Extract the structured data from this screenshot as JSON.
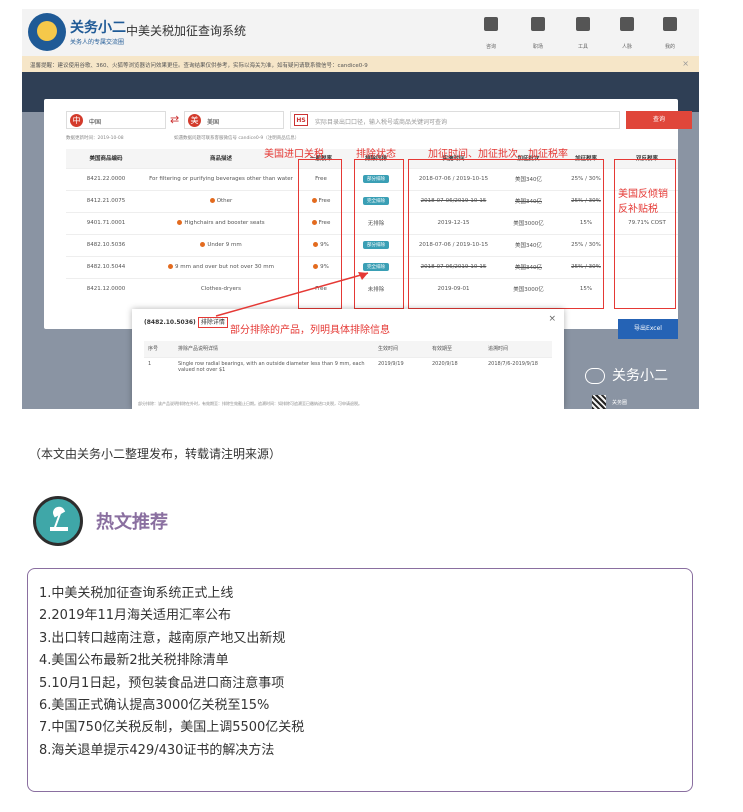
{
  "app": {
    "brand": "关务小二",
    "brand_sub": "关务人的专属交流圈",
    "system_title": "中美关税加征查询系统"
  },
  "nav": [
    {
      "label": "咨询",
      "icon": "news-icon"
    },
    {
      "label": "职场",
      "icon": "briefcase-icon"
    },
    {
      "label": "工具",
      "icon": "tools-icon"
    },
    {
      "label": "人脉",
      "icon": "people-icon"
    },
    {
      "label": "我的",
      "icon": "user-icon"
    }
  ],
  "notice": {
    "text": "温馨提醒：建议使用谷歌、360、火狐等浏览器访问效果更佳。查询结果仅供参考，实际以海关为准，如有疑问请联系微信号：candice0-9",
    "close": "×"
  },
  "search": {
    "origin": "中国",
    "origin_flag": "中",
    "dest": "美国",
    "dest_flag": "美",
    "swap": "⇄",
    "hs_tag": "HS",
    "placeholder": "实际目录出口口径，输入税号或商品关键词可查询",
    "button": "查询",
    "meta1": "数据更新时间：2019-10-08",
    "meta2": "如遇数据问题可联系客服微信号 candice0-9（注明商品信息）"
  },
  "table": {
    "headers": [
      "美国商品编码",
      "商品描述",
      "一般税率",
      "排除同排",
      "实施时间",
      "加征批次",
      "加征税率",
      "双反税率"
    ],
    "rows": [
      {
        "code": "8421.22.0000",
        "desc": "For filtering or purifying beverages other than water",
        "rate": "Free",
        "dot": false,
        "exclusion": "部分排除",
        "excl_color": "#3a9fb5",
        "time": "2018-07-06 / 2019-10-15",
        "batch": "美国340亿",
        "add": "25% / 30%",
        "strike": false,
        "cvd": ""
      },
      {
        "code": "8412.21.0075",
        "desc": "Other",
        "rate": "Free",
        "dot": true,
        "exclusion": "完全排除",
        "excl_color": "#3a9fb5",
        "time": "2018-07-06/2019-10-15",
        "batch": "美国340亿",
        "add": "25% / 30%",
        "strike": true,
        "cvd": ""
      },
      {
        "code": "9401.71.0001",
        "desc": "Highchairs and booster seats",
        "rate": "Free",
        "dot": true,
        "exclusion": "无排除",
        "excl_color": "",
        "time": "2019-12-15",
        "batch": "美国3000亿",
        "add": "15%",
        "strike": false,
        "cvd": "79.71% COST"
      },
      {
        "code": "8482.10.5036",
        "desc": "Under 9 mm",
        "rate": "9%",
        "dot": true,
        "exclusion": "部分排除",
        "excl_color": "#3a9fb5",
        "time": "2018-07-06 / 2019-10-15",
        "batch": "美国340亿",
        "add": "25% / 30%",
        "strike": false,
        "cvd": ""
      },
      {
        "code": "8482.10.5044",
        "desc": "9 mm and over but not over 30 mm",
        "rate": "9%",
        "dot": true,
        "exclusion": "完全排除",
        "excl_color": "#3a9fb5",
        "time": "2018-07-06/2019-10-15",
        "batch": "美国340亿",
        "add": "25% / 30%",
        "strike": true,
        "cvd": ""
      },
      {
        "code": "8421.12.0000",
        "desc": "Clothes-dryers",
        "rate": "Free",
        "dot": false,
        "exclusion": "未排除",
        "excl_color": "",
        "time": "2019-09-01",
        "batch": "美国3000亿",
        "add": "15%",
        "strike": false,
        "cvd": ""
      }
    ]
  },
  "annotations": {
    "rate_label": "美国进口关税",
    "excl_label": "排除状态",
    "time_label": "加征时间、加征批次、加征税率",
    "cvd_label": "美国反倾销反补贴税",
    "partial_label": "部分排除的产品，列明具体排除信息"
  },
  "modal": {
    "title_code": "(8482.10.5036)",
    "title_mark": "排除详情",
    "close": "×",
    "headers": [
      "序号",
      "排除产品说明详情",
      "生效时间",
      "有效期至",
      "追溯时间"
    ],
    "rows": [
      {
        "no": "1",
        "detail": "Single row radial bearings, with an outside diameter less than 9 mm, each valued not over $1",
        "start": "2019/9/19",
        "end": "2020/9/18",
        "retro": "2018/7/6-2019/9/18"
      }
    ],
    "footer": "部分排除：该产品说明排除在外时，有效期至：排除生效截止日期。追溯时间：如排除可追溯至已缴纳进口关税，可申请退税。"
  },
  "excel_button": "导出Excel",
  "watermark": "关务小二",
  "watermark_small": "关务圈",
  "source_note": "（本文由关务小二整理发布，转载请注明来源）",
  "recommend": {
    "title": "热文推荐",
    "items": [
      "1.中美关税加征查询系统正式上线",
      "2.2019年11月海关适用汇率公布",
      "3.出口转口越南注意，越南原产地又出新规",
      "4.美国公布最新2批关税排除清单",
      "5.10月1日起，预包装食品进口商注意事项",
      "6.美国正式确认提高3000亿关税至15%",
      "7.中国750亿关税反制，美国上调5500亿关税",
      "8.海关退单提示429/430证书的解决方法"
    ]
  }
}
